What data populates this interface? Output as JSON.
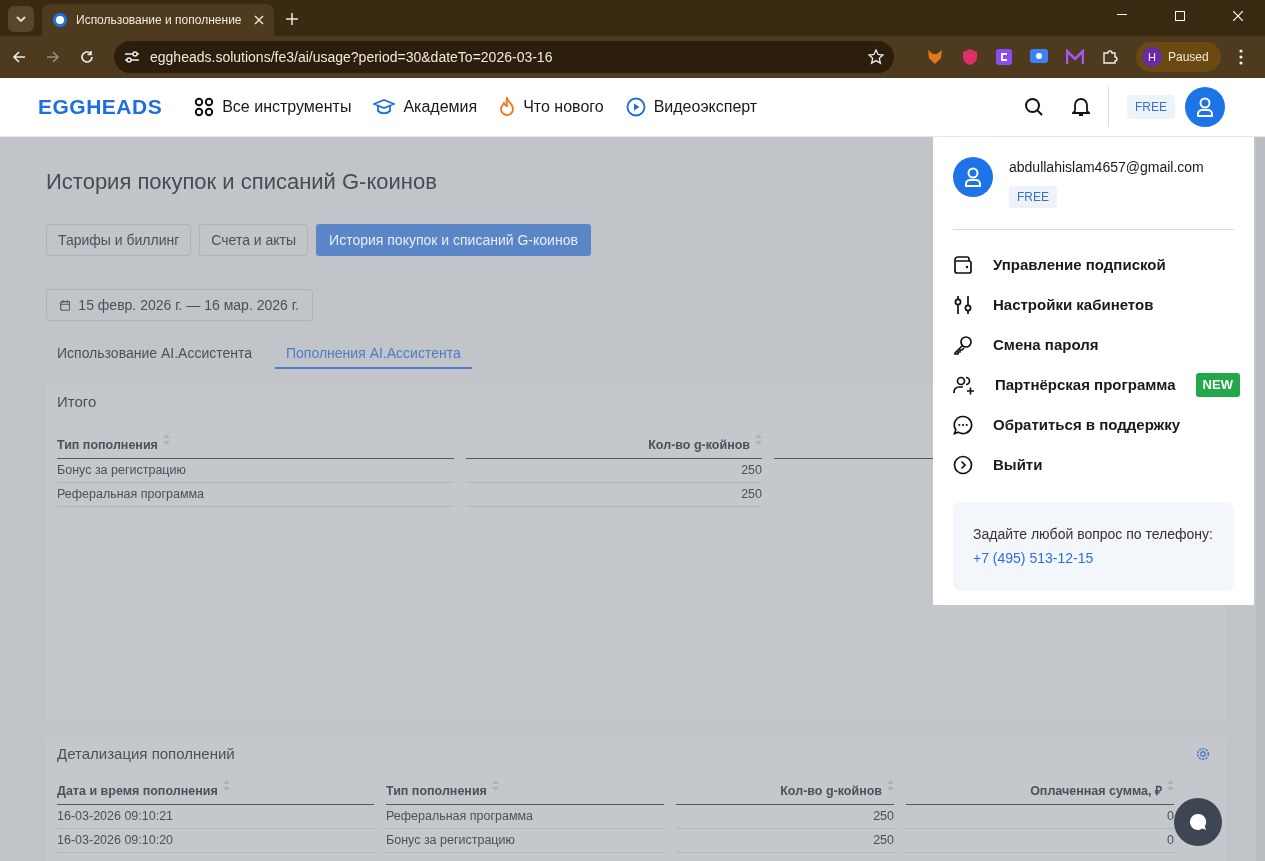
{
  "browser": {
    "tab_title": "Использование и пополнение",
    "url": "eggheads.solutions/fe3/ai/usage?period=30&dateTo=2026-03-16",
    "profile_initial": "H",
    "profile_label": "Paused"
  },
  "header": {
    "logo": "EGGHEADS",
    "nav": [
      {
        "label": "Все инструменты"
      },
      {
        "label": "Академия"
      },
      {
        "label": "Что нового"
      },
      {
        "label": "Видеоэксперт"
      }
    ],
    "plan_badge": "FREE"
  },
  "page": {
    "title": "История покупок и списаний G-коинов",
    "billing_tabs": [
      {
        "label": "Тарифы и биллинг",
        "selected": false
      },
      {
        "label": "Счета и акты",
        "selected": false
      },
      {
        "label": "История покупок и списаний G-коинов",
        "selected": true
      }
    ],
    "date_range": "15 февр. 2026 г. — 16 мар. 2026 г.",
    "section_tabs": [
      {
        "label": "Использование AI.Ассистента",
        "selected": false
      },
      {
        "label": "Пополнения AI.Ассистента",
        "selected": true
      }
    ],
    "summary": {
      "title": "Итого",
      "columns": [
        {
          "label": "Тип пополнения",
          "kind": "text"
        },
        {
          "label": "Кол-во g-койнов",
          "kind": "number"
        }
      ],
      "rows": [
        [
          "Бонус за регистрацию",
          "250"
        ],
        [
          "Реферальная программа",
          "250"
        ]
      ]
    },
    "details": {
      "title": "Детализация пополнений",
      "columns": [
        {
          "label": "Дата и время пополнения",
          "kind": "text"
        },
        {
          "label": "Тип пополнения",
          "kind": "text"
        },
        {
          "label": "Кол-во g-койнов",
          "kind": "number"
        },
        {
          "label": "Оплаченная сумма, ₽",
          "kind": "number"
        }
      ],
      "rows": [
        [
          "16-03-2026 09:10:21",
          "Реферальная программа",
          "250",
          "0"
        ],
        [
          "16-03-2026 09:10:20",
          "Бонус за регистрацию",
          "250",
          "0"
        ]
      ]
    }
  },
  "account_menu": {
    "email": "abdullahislam4657@gmail.com",
    "plan": "FREE",
    "items": [
      {
        "label": "Управление подпиской"
      },
      {
        "label": "Настройки кабинетов"
      },
      {
        "label": "Смена пароля"
      },
      {
        "label": "Партнёрская программа",
        "badge": "NEW"
      },
      {
        "label": "Обратиться в поддержку"
      },
      {
        "label": "Выйти"
      }
    ],
    "support_text": "Задайте любой вопрос по телефону:",
    "phone": "+7 (495) 513-12-15"
  }
}
